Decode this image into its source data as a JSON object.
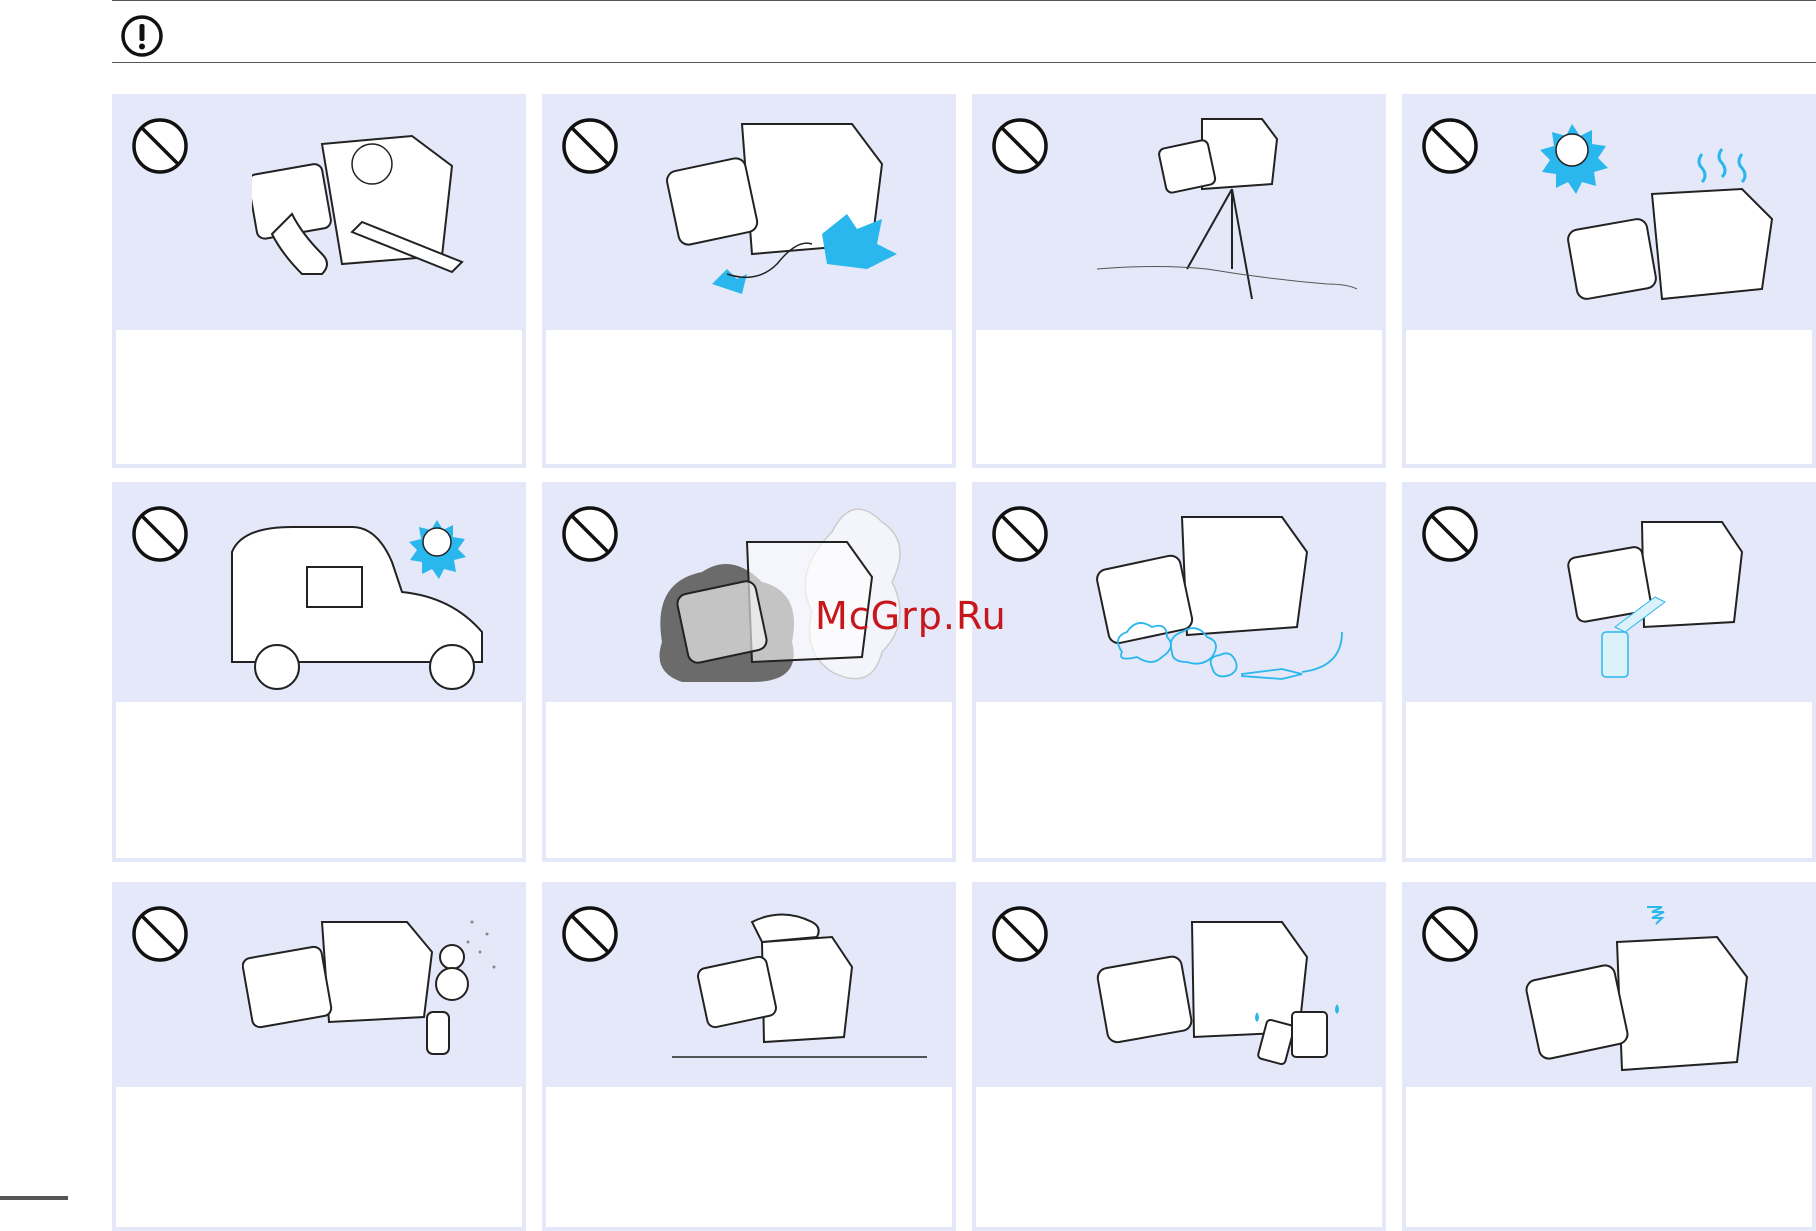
{
  "watermark": "McGrp.Ru",
  "cards": [
    {
      "caption": "",
      "icon": "no-disassemble-icon"
    },
    {
      "caption": "",
      "icon": "no-shock-icon"
    },
    {
      "caption": "",
      "icon": "no-unstable-tripod-icon"
    },
    {
      "caption": "",
      "icon": "no-direct-sunlight-icon"
    },
    {
      "caption": "",
      "icon": "no-hot-car-icon"
    },
    {
      "caption": "",
      "icon": "no-smoke-icon"
    },
    {
      "caption": "",
      "icon": "no-dust-icon"
    },
    {
      "caption": "",
      "icon": "no-spray-icon"
    },
    {
      "caption": "",
      "icon": "no-condensation-icon"
    },
    {
      "caption": "",
      "icon": "no-drop-icon"
    },
    {
      "caption": "",
      "icon": "no-battery-leak-icon"
    },
    {
      "caption": "",
      "icon": "no-magnetic-field-icon"
    }
  ]
}
